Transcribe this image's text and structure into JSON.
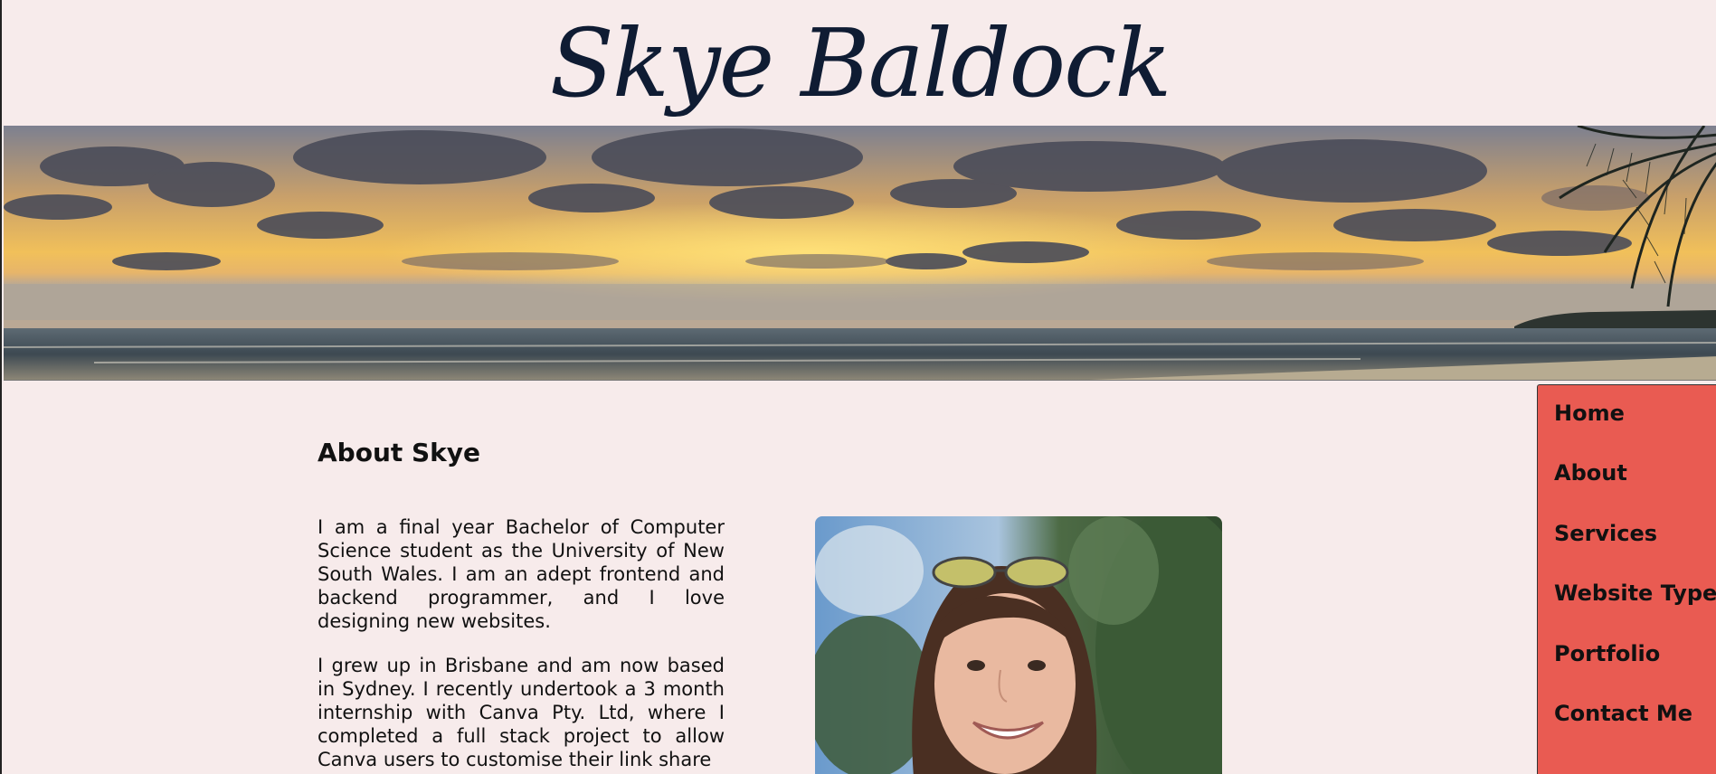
{
  "site": {
    "title": "Skye Baldock"
  },
  "nav": {
    "items": [
      {
        "label": "Home"
      },
      {
        "label": "About"
      },
      {
        "label": "Services"
      },
      {
        "label": "Website Types"
      },
      {
        "label": "Portfolio"
      },
      {
        "label": "Contact Me"
      }
    ]
  },
  "about": {
    "heading": "About Skye",
    "paragraphs": [
      "I am a final year Bachelor of Computer Science student as the University of New South Wales. I am an adept frontend and backend programmer, and I love designing new websites.",
      "I grew up in Brisbane and am now based in Sydney. I recently undertook a 3 month internship with Canva Pty. Ltd, where I completed a full stack project to allow Canva users to customise their link share"
    ]
  },
  "colors": {
    "background": "#f7ebeb",
    "nav_background": "#e95b52",
    "title_color": "#0f1c33"
  }
}
